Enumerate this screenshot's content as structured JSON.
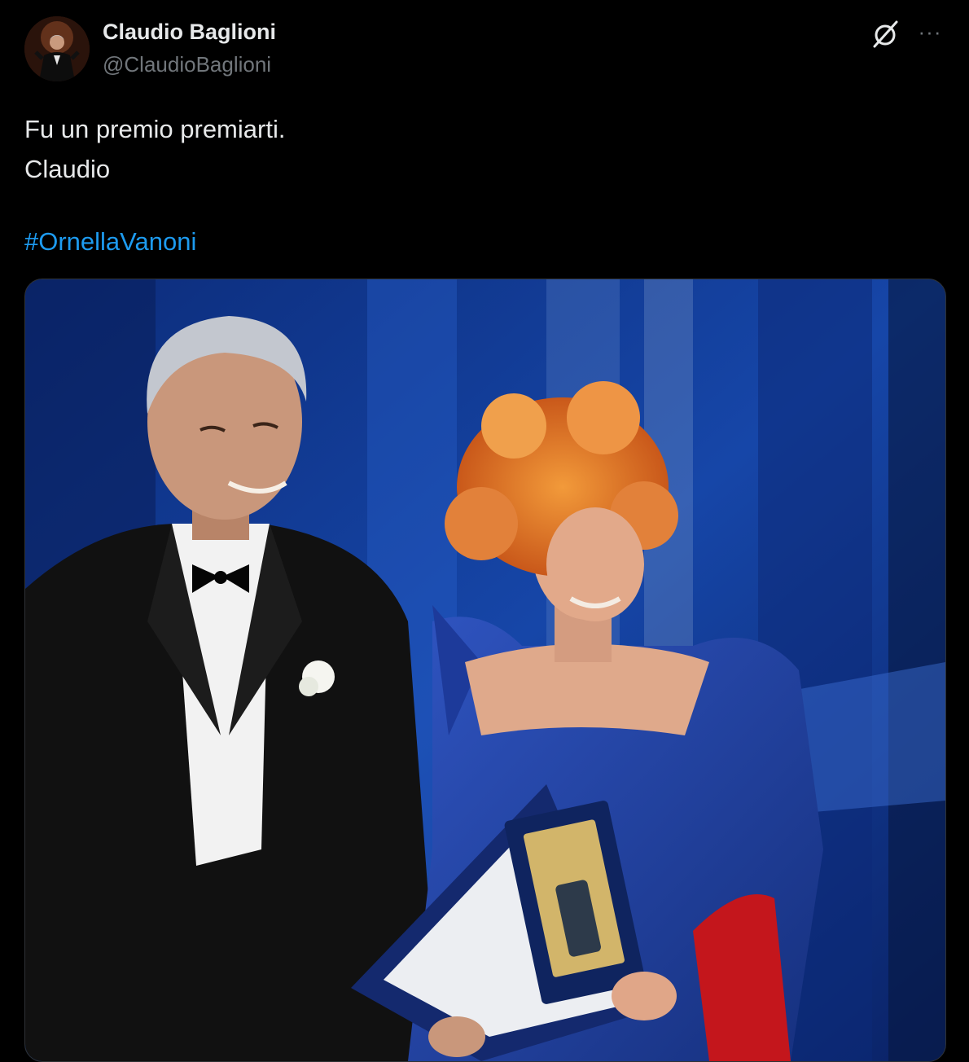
{
  "author": {
    "name": "Claudio Baglioni",
    "handle": "@ClaudioBaglioni"
  },
  "icons": {
    "grok": "grok-icon",
    "more": "more-icon"
  },
  "more_glyph": "···",
  "tweet": {
    "lines": [
      "Fu un premio premiarti.",
      "Claudio"
    ],
    "hashtag": "#OrnellaVanoni"
  },
  "colors": {
    "background": "#000000",
    "text": "#e7e9ea",
    "secondary": "#71767b",
    "link": "#1d9bf0"
  }
}
